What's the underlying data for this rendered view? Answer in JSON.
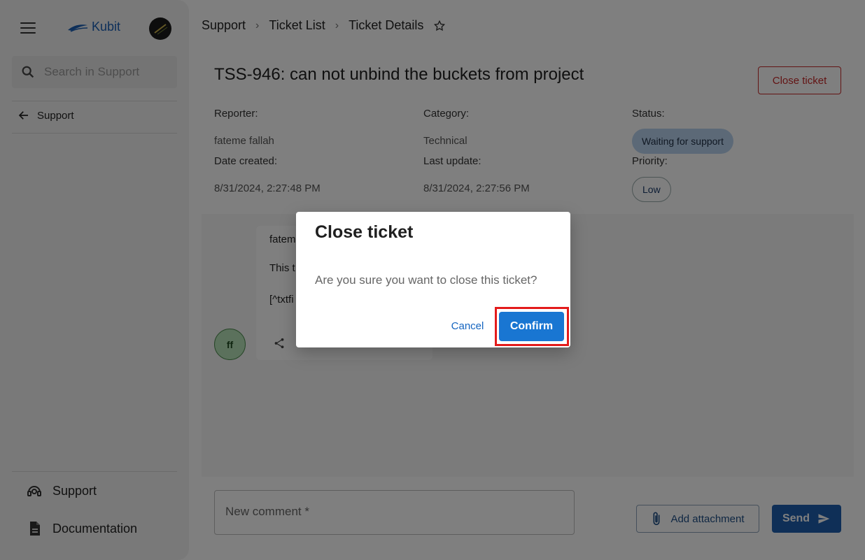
{
  "sidebar": {
    "app_name": "Kubit",
    "search_placeholder": "Search in Support",
    "back_label": "Support",
    "bottom_items": [
      {
        "label": "Support",
        "icon": "support-agent-icon"
      },
      {
        "label": "Documentation",
        "icon": "document-icon"
      }
    ]
  },
  "breadcrumb": [
    "Support",
    "Ticket List",
    "Ticket Details"
  ],
  "ticket": {
    "title": "TSS-946: can not unbind the buckets from project",
    "close_label": "Close ticket",
    "reporter_label": "Reporter:",
    "reporter": "fateme fallah",
    "category_label": "Category:",
    "category": "Technical",
    "status_label": "Status:",
    "status": "Waiting for support",
    "date_created_label": "Date created:",
    "date_created": "8/31/2024, 2:27:48 PM",
    "last_update_label": "Last update:",
    "last_update": "8/31/2024, 2:27:56 PM",
    "priority_label": "Priority:",
    "priority": "Low"
  },
  "comment": {
    "author": "fatem",
    "line1": "This t",
    "line2": "[^txtfi",
    "avatar": "ff"
  },
  "composer": {
    "placeholder": "New comment *",
    "attach_label": "Add attachment",
    "send_label": "Send"
  },
  "dialog": {
    "title": "Close ticket",
    "message": "Are you sure you want to close this ticket?",
    "cancel_label": "Cancel",
    "confirm_label": "Confirm"
  },
  "colors": {
    "accent": "#1976d2",
    "danger": "#c62828",
    "highlight": "#e31b1b"
  }
}
